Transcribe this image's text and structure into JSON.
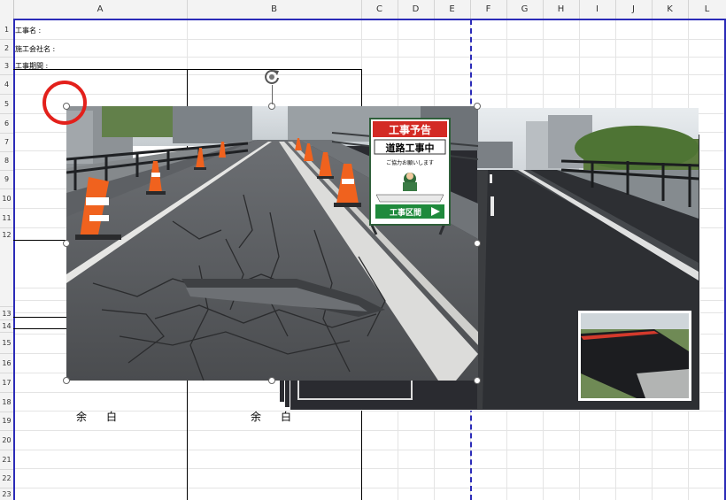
{
  "columns": [
    "A",
    "B",
    "C",
    "D",
    "E",
    "F",
    "G",
    "H",
    "I",
    "J",
    "K",
    "L"
  ],
  "rows": [
    "1",
    "2",
    "3",
    "4",
    "5",
    "6",
    "7",
    "8",
    "9",
    "10",
    "11",
    "12",
    "13",
    "14",
    "15",
    "16",
    "17",
    "18",
    "19",
    "20",
    "21",
    "22",
    "23"
  ],
  "form": {
    "project_name_label": "工事名 :",
    "company_label": "施工会社名 :",
    "period_label": "工事期間 :"
  },
  "margin_left": "余白",
  "margin_right": "余白",
  "sign": {
    "header": "工事予告",
    "title": "道路工事中",
    "subtitle": "ご協力お願いします",
    "zone": "工事区間"
  },
  "colors": {
    "print_area": "#2b2bb8",
    "highlight": "#e3201b",
    "sign_red": "#d32a24",
    "sign_green": "#1f8a3c",
    "cone_orange": "#f0621e"
  },
  "icons": {
    "rotate": "rotate-handle-icon",
    "selection": "resize-handle"
  }
}
